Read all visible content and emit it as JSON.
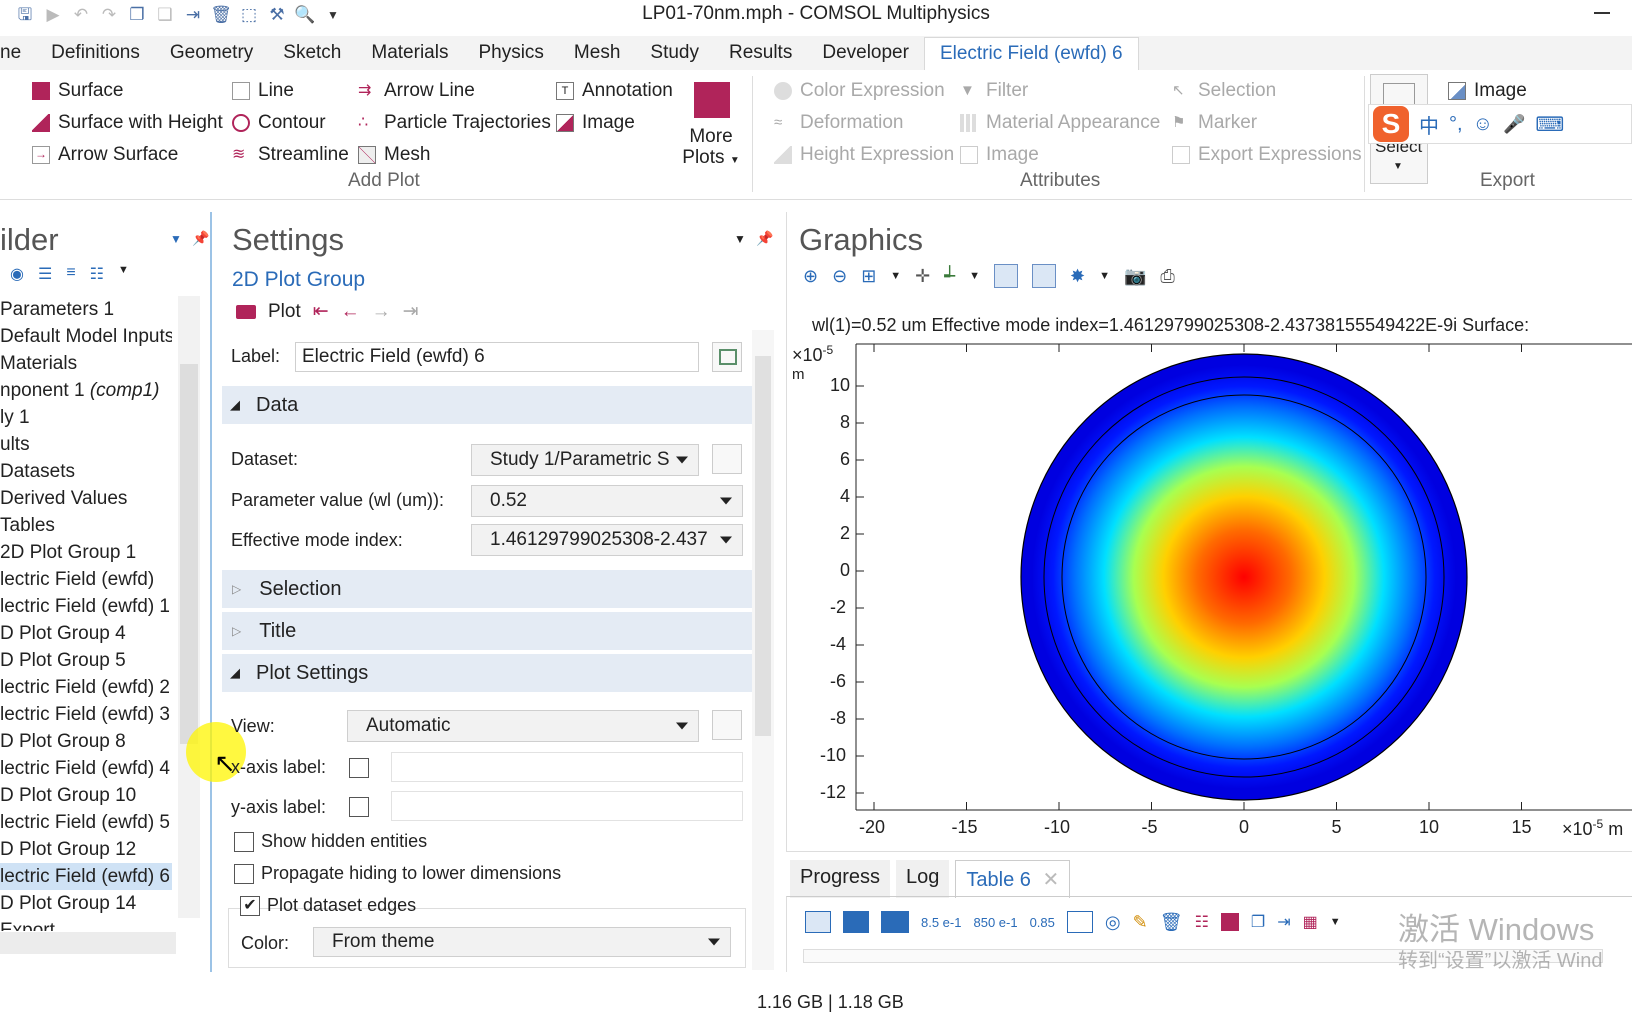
{
  "window": {
    "title": "LP01-70nm.mph - COMSOL Multiphysics"
  },
  "menu": [
    "ne",
    "Definitions",
    "Geometry",
    "Sketch",
    "Materials",
    "Physics",
    "Mesh",
    "Study",
    "Results",
    "Developer",
    "Electric Field (ewfd) 6"
  ],
  "ribbon": {
    "add_plot": {
      "col1": [
        "Surface",
        "Surface with Height",
        "Arrow Surface"
      ],
      "col2": [
        "Line",
        "Contour",
        "Streamline"
      ],
      "col3": [
        "Arrow Line",
        "Particle Trajectories",
        "Mesh"
      ],
      "col4": [
        "Annotation",
        "Image"
      ],
      "more_line1": "More",
      "more_line2": "Plots",
      "group_label": "Add Plot"
    },
    "attributes": {
      "col1": [
        "Color Expression",
        "Deformation",
        "Height Expression"
      ],
      "col2": [
        "Filter",
        "Material Appearance",
        "Image"
      ],
      "col3": [
        "Selection",
        "Marker",
        "Export Expressions"
      ],
      "group_label": "Attributes"
    },
    "export": {
      "select_label": "Select",
      "image": "Image",
      "group_label": "Export"
    },
    "ime": {
      "mode": "中"
    }
  },
  "builder": {
    "title": "ilder",
    "tree": [
      "Parameters 1",
      "Default Model Inputs",
      "Materials",
      "nponent 1",
      "ly 1",
      "ults",
      "Datasets",
      "Derived Values",
      "Tables",
      "2D Plot Group 1",
      "lectric Field (ewfd)",
      "lectric Field (ewfd) 1",
      "D Plot Group 4",
      "D Plot Group 5",
      "lectric Field (ewfd) 2",
      "lectric Field (ewfd) 3",
      "D Plot Group 8",
      "lectric Field (ewfd) 4",
      "D Plot Group 10",
      "lectric Field (ewfd) 5",
      "D Plot Group 12",
      "lectric Field (ewfd) 6",
      "D Plot Group 14",
      "Export"
    ],
    "comp_suffix": "(comp1)"
  },
  "settings": {
    "title": "Settings",
    "subtitle": "2D Plot Group",
    "plot_button": "Plot",
    "label_caption": "Label:",
    "label_value": "Electric Field (ewfd) 6",
    "data_section": "Data",
    "dataset_caption": "Dataset:",
    "dataset_value": "Study 1/Parametric S",
    "param_caption": "Parameter value (wl (um)):",
    "param_value": "0.52",
    "emi_caption": "Effective mode index:",
    "emi_value": "1.46129799025308-2.437",
    "selection_section": "Selection",
    "title_section": "Title",
    "plot_settings_section": "Plot Settings",
    "view_caption": "View:",
    "view_value": "Automatic",
    "xaxis_caption": "x-axis label:",
    "yaxis_caption": "y-axis label:",
    "show_hidden": "Show hidden entities",
    "propagate": "Propagate hiding to lower dimensions",
    "plot_edges": "Plot dataset edges",
    "color_caption": "Color:",
    "color_value": "From theme"
  },
  "graphics": {
    "title": "Graphics",
    "plot_title": "wl(1)=0.52 um  Effective mode index=1.46129799025308-2.43738155549422E-9i   Surface:",
    "y_exponent": "×10",
    "y_exp_power": "-5",
    "y_unit": "m",
    "x_exponent": "×10",
    "x_exp_power": "-5",
    "x_unit": "m",
    "y_ticks": [
      "10",
      "8",
      "6",
      "4",
      "2",
      "0",
      "-2",
      "-4",
      "-6",
      "-8",
      "-10",
      "-12"
    ],
    "x_ticks": [
      "-20",
      "-15",
      "-10",
      "-5",
      "0",
      "5",
      "10",
      "15"
    ]
  },
  "bottom": {
    "tabs": [
      "Progress",
      "Log",
      "Table 6"
    ],
    "toolbar_labels": [
      "8.5 e-1",
      "850 e-1",
      "0.85"
    ],
    "watermark_line1": "激活 Windows",
    "watermark_line2": "转到“设置”以激活 Wind"
  },
  "status": {
    "memory": "1.16 GB | 1.18 GB"
  },
  "colors": {
    "accent": "#2a6bb8",
    "section_bg": "#e4ebf4",
    "surface_icon": "#b0245a"
  }
}
